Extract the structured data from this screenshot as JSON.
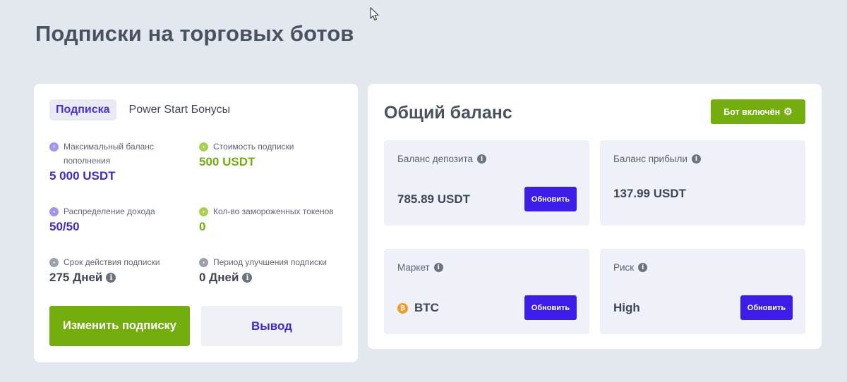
{
  "page": {
    "title": "Подписки на торговых ботов"
  },
  "subscription_card": {
    "tabs": [
      {
        "label": "Подписка",
        "active": true
      },
      {
        "label": "Power Start Бонусы",
        "active": false
      }
    ],
    "stats": {
      "max_balance": {
        "label": "Максимальный баланс пополнения",
        "value": "5 000 USDT"
      },
      "cost": {
        "label": "Стоимость подписки",
        "value": "500 USDT"
      },
      "income_split": {
        "label": "Распределение дохода",
        "value": "50/50"
      },
      "frozen_tokens": {
        "label": "Кол-во замороженных токенов",
        "value": "0"
      },
      "validity": {
        "label": "Срок действия подписки",
        "value": "275 Дней"
      },
      "upgrade_period": {
        "label": "Период улучшения подписки",
        "value": "0 Дней"
      }
    },
    "change_button": "Изменить подписку",
    "withdraw_button": "Вывод"
  },
  "balance_card": {
    "title": "Общий баланс",
    "bot_button": "Бот включён",
    "deposit": {
      "label": "Баланс депозита",
      "value": "785.89 USDT",
      "button": "Обновить"
    },
    "profit": {
      "label": "Баланс прибыли",
      "value": "137.99 USDT"
    },
    "market": {
      "label": "Маркет",
      "value": "BTC",
      "icon_glyph": "₿",
      "button": "Обновить"
    },
    "risk": {
      "label": "Риск",
      "value": "High",
      "button": "Обновить"
    }
  },
  "colors": {
    "accent_purple": "#3d2bd0",
    "accent_green": "#73ad0e",
    "button_blue": "#3d1de8",
    "background": "#e3e8ef"
  }
}
